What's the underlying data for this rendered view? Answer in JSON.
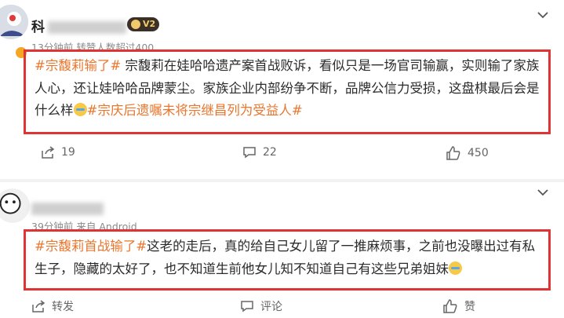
{
  "posts": [
    {
      "username": "科",
      "vip_level": "2",
      "meta": "13分钟前  转赞人数超过400",
      "segments": [
        {
          "text": "#宗馥莉输了#",
          "tag": true
        },
        {
          "text": " 宗馥莉在娃哈哈遗产案首战败诉，看似只是一场官司输赢，实则输了家族人心，还让娃哈哈品牌蒙尘。家族企业内部纷争不断，品牌公信力受损，这盘棋最后会是什么样",
          "tag": false
        },
        {
          "emoji": "laugh-cry"
        },
        {
          "text": "#宗庆后遗嘱未将宗继昌列为受益人#",
          "tag": true
        }
      ],
      "actions": {
        "share": "19",
        "comment": "22",
        "like": "450"
      }
    },
    {
      "username": "",
      "meta": "39分钟前  来自 Android",
      "segments": [
        {
          "text": "#宗馥莉首战输了#",
          "tag": true
        },
        {
          "text": "这老的走后，真的给自己女儿留了一推麻烦事，之前也没曝出过有私生子，隐藏的太好了，也不知道生前他女儿知不知道自己有这些兄弟姐妹",
          "tag": false
        },
        {
          "emoji": "laugh-cry"
        }
      ],
      "actions": {
        "share": "转发",
        "comment": "评论",
        "like": "赞"
      }
    }
  ],
  "colors": {
    "tag": "#e8762d",
    "highlight_box": "#e03434",
    "text": "#2b2b2b",
    "meta": "#8a8a8a"
  }
}
